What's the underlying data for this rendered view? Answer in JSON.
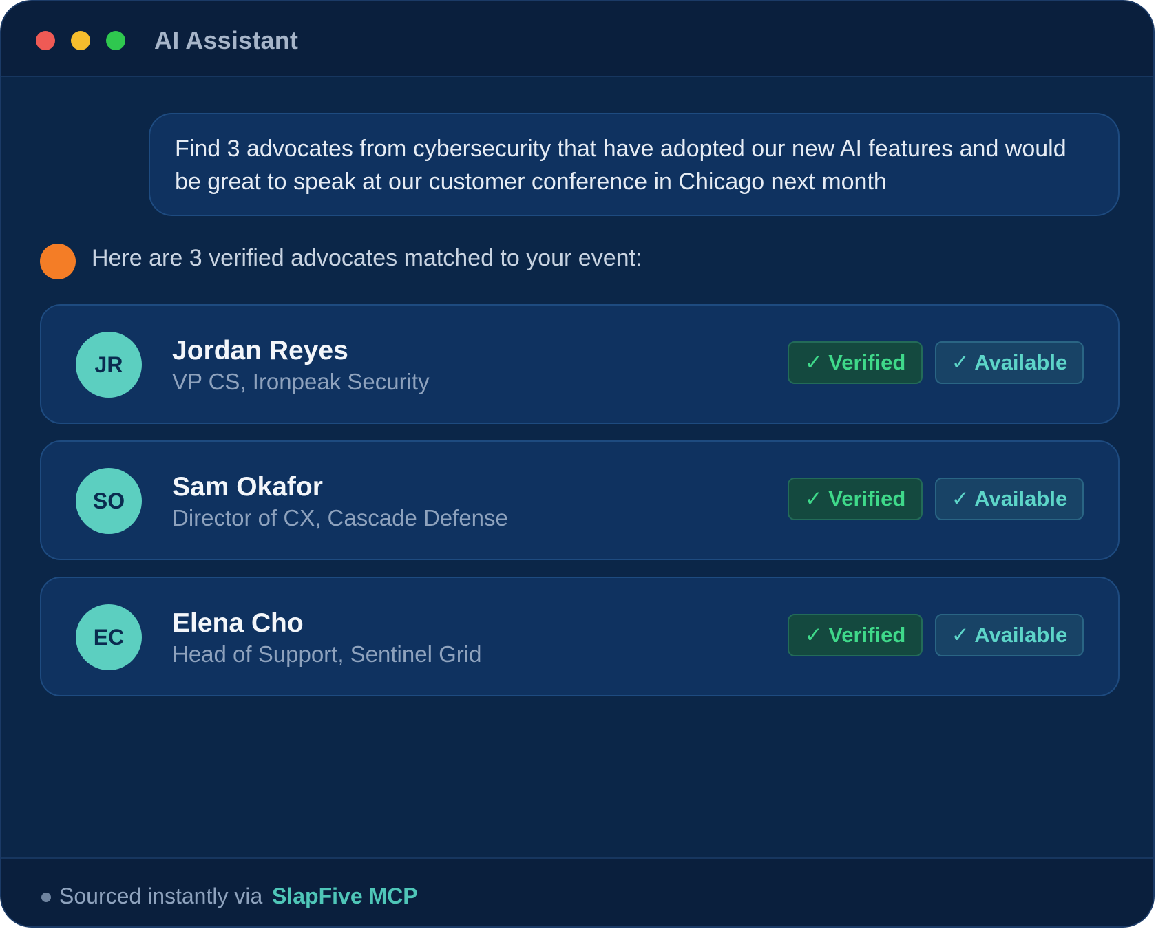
{
  "window": {
    "title": "AI Assistant",
    "controls": [
      "close",
      "minimize",
      "maximize"
    ]
  },
  "conversation": {
    "user_message": "Find 3 advocates from cybersecurity that have adopted our new AI features and would be great to speak at our customer conference in Chicago next month",
    "assistant_message": "Here are 3 verified advocates matched to your event:"
  },
  "advocates": [
    {
      "initials": "JR",
      "name": "Jordan Reyes",
      "role": "VP CS, Ironpeak Security",
      "verified_label": "✓ Verified",
      "available_label": "✓ Available"
    },
    {
      "initials": "SO",
      "name": "Sam Okafor",
      "role": "Director of CX, Cascade Defense",
      "verified_label": "✓ Verified",
      "available_label": "✓ Available"
    },
    {
      "initials": "EC",
      "name": "Elena Cho",
      "role": "Head of Support, Sentinel Grid",
      "verified_label": "✓ Verified",
      "available_label": "✓ Available"
    }
  ],
  "footer": {
    "text": "Sourced instantly via",
    "brand": "SlapFive MCP"
  },
  "colors": {
    "background": "#0b2648",
    "titlebar": "#0a1f3d",
    "card": "#0f3260",
    "assistant_avatar": "#f47d26",
    "advocate_avatar": "#5ccfc0",
    "verified": "#3fd98a",
    "available": "#5dd5c8",
    "brand": "#4fc6b8"
  }
}
